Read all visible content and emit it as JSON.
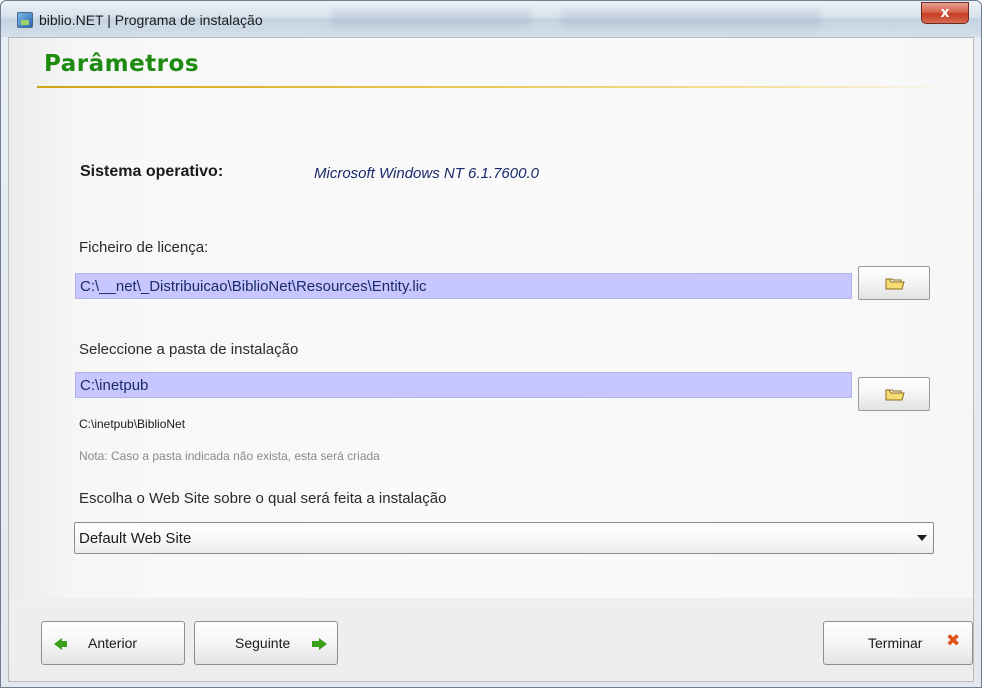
{
  "window": {
    "title": "biblio.NET | Programa de instalação",
    "close_label": "x"
  },
  "page": {
    "title": "Parâmetros"
  },
  "system": {
    "label": "Sistema operativo:",
    "value": "Microsoft Windows NT 6.1.7600.0"
  },
  "license": {
    "label": "Ficheiro de licença:",
    "value": "C:\\__net\\_Distribuicao\\BiblioNet\\Resources\\Entity.lic"
  },
  "install_folder": {
    "label": "Seleccione a pasta de instalação",
    "value": "C:\\inetpub",
    "resolved_path": "C:\\inetpub\\BiblioNet",
    "note": "Nota: Caso a pasta indicada não exista, esta será criada"
  },
  "website": {
    "label": "Escolha o Web Site sobre o qual será feita a instalação",
    "selected": "Default Web Site"
  },
  "footer": {
    "back_label": "Anterior",
    "next_label": "Seguinte",
    "finish_label": "Terminar"
  },
  "icons": {
    "app": "installer-app-icon",
    "browse": "folder-icon",
    "back": "arrow-left-icon",
    "next": "arrow-right-icon",
    "finish": "x-icon"
  },
  "colors": {
    "title_green": "#1d8a10",
    "field_bg": "#c7c6ff",
    "arrow_green": "#3aa019",
    "finish_orange": "#e0541c"
  }
}
